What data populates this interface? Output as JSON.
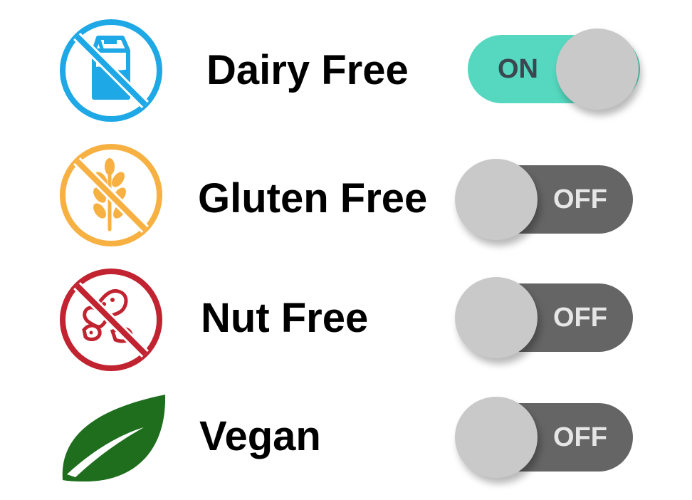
{
  "colors": {
    "dairy_icon": "#1ea8e6",
    "gluten_icon": "#f7b142",
    "nut_icon": "#c12330",
    "vegan_icon": "#1e6e1e",
    "toggle_on": "#55d8bf",
    "toggle_off": "#656565",
    "knob": "#c9c9c9"
  },
  "options": [
    {
      "label": "Dairy Free",
      "icon": "milk-carton-crossed-icon",
      "state": "ON"
    },
    {
      "label": "Gluten Free",
      "icon": "wheat-crossed-icon",
      "state": "OFF"
    },
    {
      "label": "Nut Free",
      "icon": "peanut-crossed-icon",
      "state": "OFF"
    },
    {
      "label": "Vegan",
      "icon": "leaf-icon",
      "state": "OFF"
    }
  ]
}
